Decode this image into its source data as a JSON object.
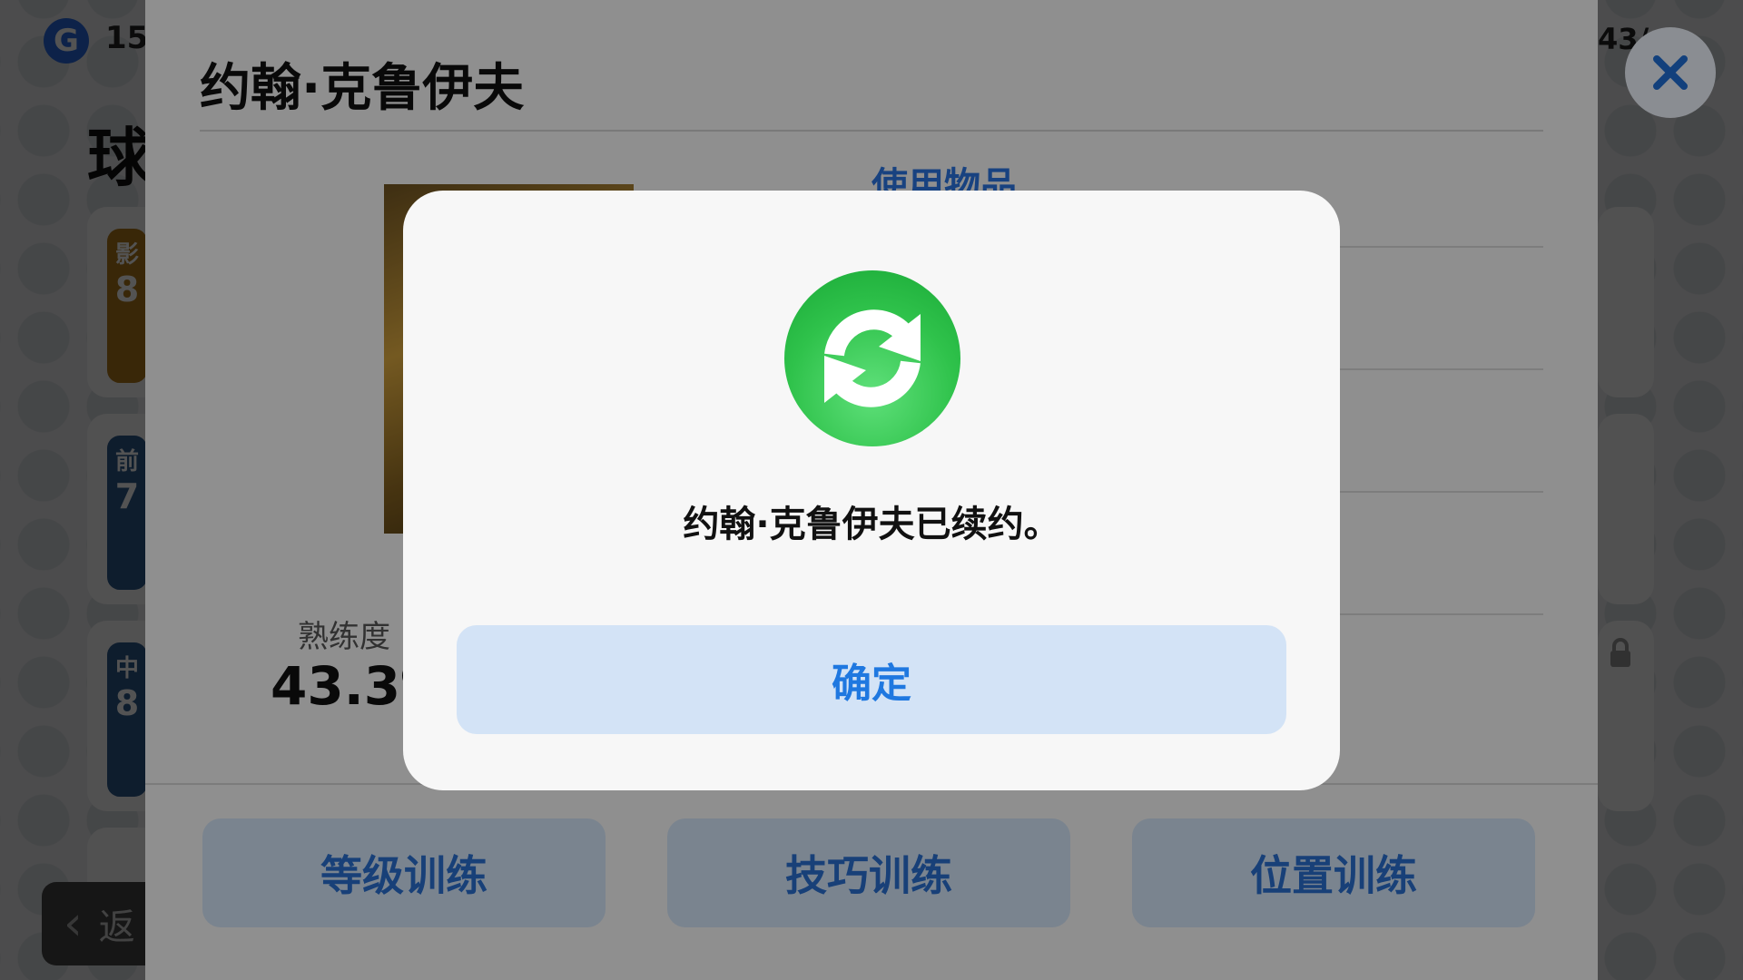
{
  "background": {
    "currency_value": "15",
    "right_counter": "43/",
    "heading": "球",
    "cards": [
      {
        "position": "影",
        "rating": "8"
      },
      {
        "position": "前",
        "rating": "7"
      },
      {
        "position": "中",
        "rating": "8"
      }
    ],
    "back_label": "返"
  },
  "panel": {
    "title": "约翰·克鲁伊夫",
    "section_link": "使用物品",
    "proficiency_label": "熟练度",
    "proficiency_value": "43.3%",
    "buttons": [
      {
        "label": "等级训练"
      },
      {
        "label": "技巧训练"
      },
      {
        "label": "位置训练"
      }
    ]
  },
  "dialog": {
    "message": "约翰·克鲁伊夫已续约。",
    "confirm_label": "确定",
    "icon": "renew-icon"
  },
  "colors": {
    "accent_blue": "#1f78e0",
    "button_fill": "#d3e3f6",
    "icon_green": "#2fc24b"
  }
}
